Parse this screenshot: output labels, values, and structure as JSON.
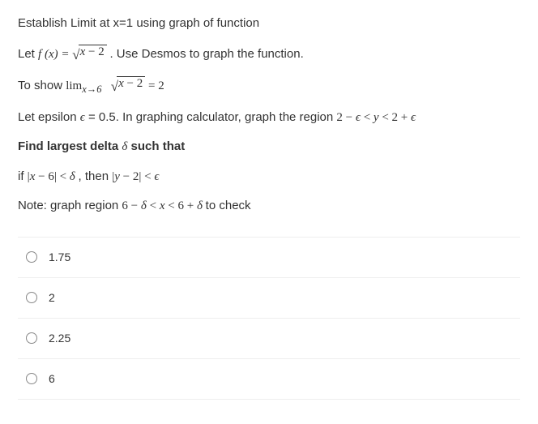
{
  "content": {
    "title": "Establish Limit at x=1 using graph of function",
    "let_prefix": "Let ",
    "let_func": "f (x) = ",
    "sqrt_expr_a": "x",
    "sqrt_expr_b": " − 2",
    "let_suffix": ". Use Desmos to graph the function.",
    "to_show_prefix": "To show ",
    "lim_text": "lim",
    "lim_sub": "x→6",
    "to_show_eq": " = 2",
    "eps_line_a": "Let epsilon ",
    "eps_sym": "ϵ",
    "eps_line_b": " = 0.5.  In graphing calculator, graph the region ",
    "eps_region": "2 − ϵ < y < 2 + ϵ",
    "find_delta_a": "Find largest delta ",
    "delta_sym": "δ",
    "find_delta_b": " such that",
    "if_line_a": "if ",
    "if_expr1": "|x − 6| < δ",
    "if_line_b": " , then ",
    "if_expr2": "|y − 2| < ϵ",
    "note_a": "Note: graph region ",
    "note_expr": "6 − δ < x < 6 + δ",
    "note_b": " to check"
  },
  "options": [
    {
      "label": "1.75"
    },
    {
      "label": "2"
    },
    {
      "label": "2.25"
    },
    {
      "label": "6"
    }
  ]
}
